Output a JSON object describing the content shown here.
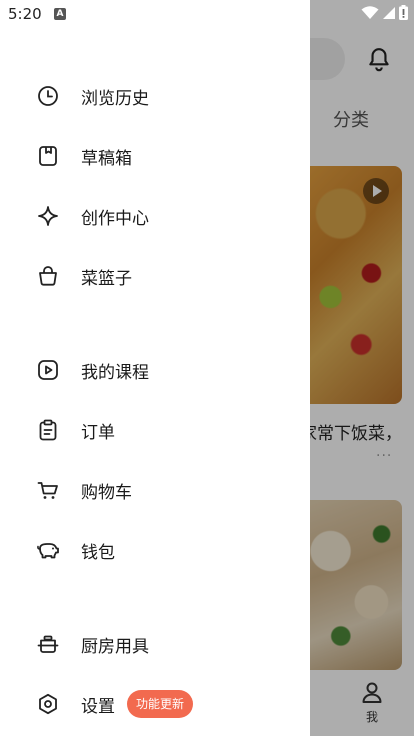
{
  "status_bar": {
    "time": "5:20",
    "notification_icon": "A"
  },
  "drawer": {
    "items": [
      {
        "name": "history",
        "label": "浏览历史",
        "icon": "clock-icon"
      },
      {
        "name": "drafts",
        "label": "草稿箱",
        "icon": "draft-icon"
      },
      {
        "name": "creator-center",
        "label": "创作中心",
        "icon": "sparkle-icon"
      },
      {
        "name": "basket",
        "label": "菜篮子",
        "icon": "basket-icon"
      },
      {
        "name": "courses",
        "label": "我的课程",
        "icon": "play-icon"
      },
      {
        "name": "orders",
        "label": "订单",
        "icon": "clipboard-icon"
      },
      {
        "name": "cart",
        "label": "购物车",
        "icon": "cart-icon"
      },
      {
        "name": "wallet",
        "label": "钱包",
        "icon": "piggy-bank-icon"
      },
      {
        "name": "kitchenware",
        "label": "厨房用具",
        "icon": "pot-icon"
      },
      {
        "name": "settings",
        "label": "设置",
        "icon": "settings-icon",
        "badge": "功能更新"
      }
    ]
  },
  "background": {
    "tab_label": "分类",
    "card_caption": "家常下饭菜，",
    "more_dots": "···",
    "bottom_tab_me": "我"
  }
}
